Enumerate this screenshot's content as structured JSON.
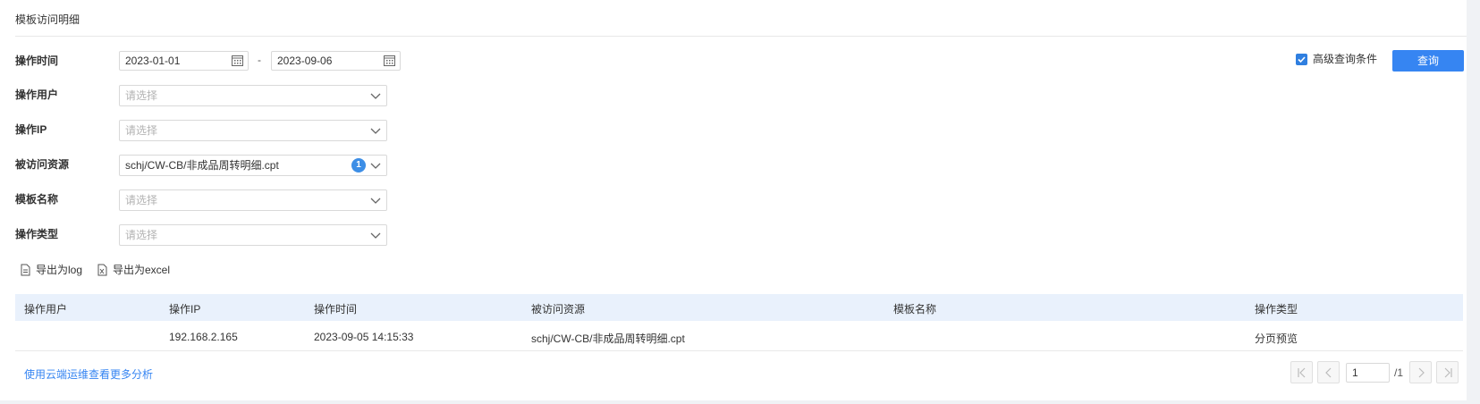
{
  "panel": {
    "title": "模板访问明细"
  },
  "filters": {
    "time": {
      "label": "操作时间",
      "start": "2023-01-01",
      "end": "2023-09-06",
      "separator": "-"
    },
    "user": {
      "label": "操作用户",
      "placeholder": "请选择"
    },
    "ip": {
      "label": "操作IP",
      "placeholder": "请选择"
    },
    "resource": {
      "label": "被访问资源",
      "value": "schj/CW-CB/非成品周转明细.cpt",
      "count": "1"
    },
    "template": {
      "label": "模板名称",
      "placeholder": "请选择"
    },
    "type": {
      "label": "操作类型",
      "placeholder": "请选择"
    }
  },
  "advanced": {
    "label": "高级查询条件",
    "checked": true
  },
  "query_button": "查询",
  "exports": {
    "log": "导出为log",
    "excel": "导出为excel"
  },
  "table": {
    "columns": [
      "操作用户",
      "操作IP",
      "操作时间",
      "被访问资源",
      "模板名称",
      "操作类型"
    ],
    "rows": [
      [
        "",
        "192.168.2.165",
        "2023-09-05 14:15:33",
        "schj/CW-CB/非成品周转明细.cpt",
        "",
        "分页预览"
      ]
    ]
  },
  "footer": {
    "link": "使用云端运维查看更多分析"
  },
  "pagination": {
    "current": "1",
    "total": "/1"
  },
  "colors": {
    "accent": "#3685f2",
    "header_bg": "#e9f1fc",
    "badge": "#3d8ee6"
  }
}
